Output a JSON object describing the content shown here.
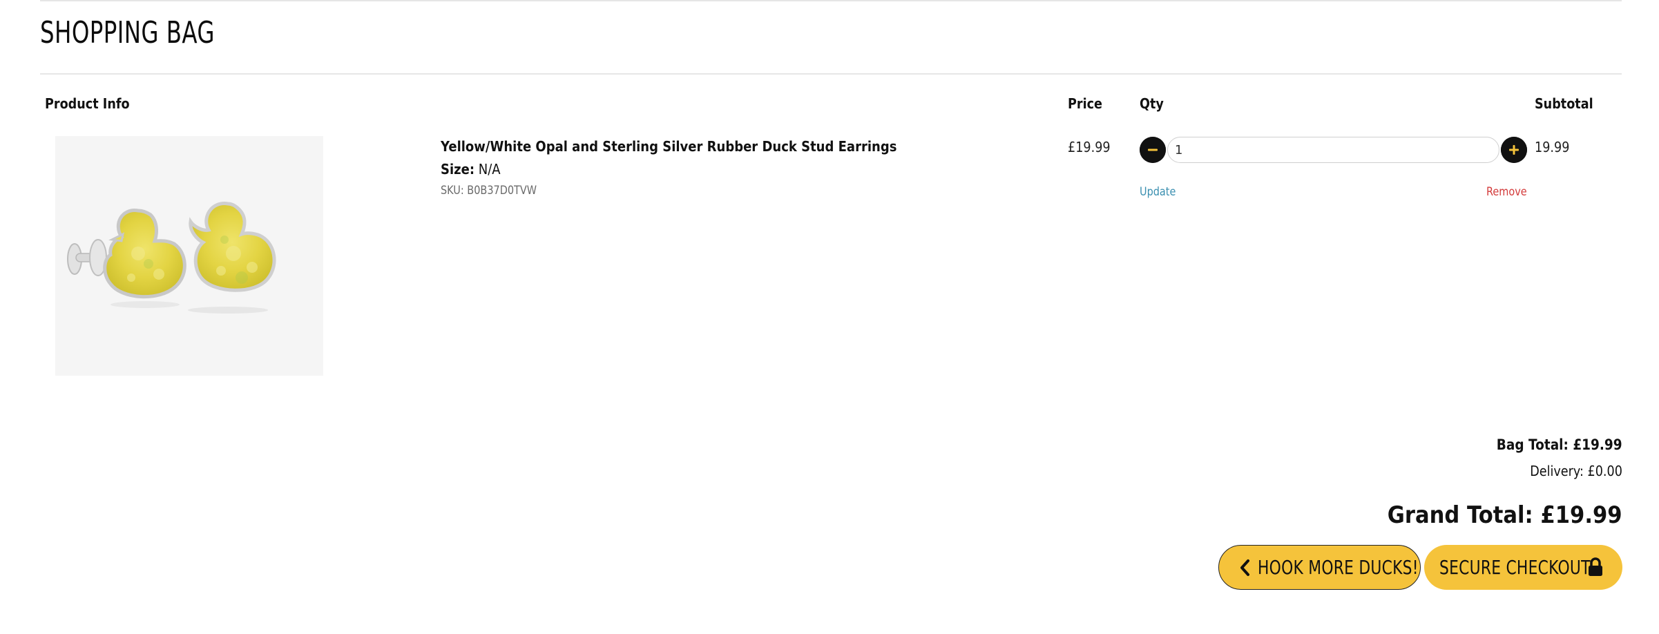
{
  "page": {
    "title": "SHOPPING BAG"
  },
  "table": {
    "headers": {
      "product": "Product Info",
      "price": "Price",
      "qty": "Qty",
      "subtotal": "Subtotal"
    }
  },
  "item": {
    "name": "Yellow/White Opal and Sterling Silver Rubber Duck Stud Earrings",
    "size_label": "Size:",
    "size_value": "N/A",
    "sku": "SKU: B0B37D0TVW",
    "price": "£19.99",
    "quantity": "1",
    "subtotal": "19.99",
    "update_label": "Update",
    "remove_label": "Remove",
    "image_icon": "duck-earrings-image"
  },
  "totals": {
    "bag_total": "Bag Total: £19.99",
    "delivery": "Delivery: £0.00",
    "grand_total": "Grand Total: £19.99"
  },
  "actions": {
    "continue_label": "HOOK MORE DUCKS!",
    "checkout_label": "SECURE CHECKOUT"
  },
  "colors": {
    "accent": "#f5c33b",
    "update_link": "#3a8fb0",
    "remove_link": "#d33b3b",
    "dark": "#111111"
  }
}
